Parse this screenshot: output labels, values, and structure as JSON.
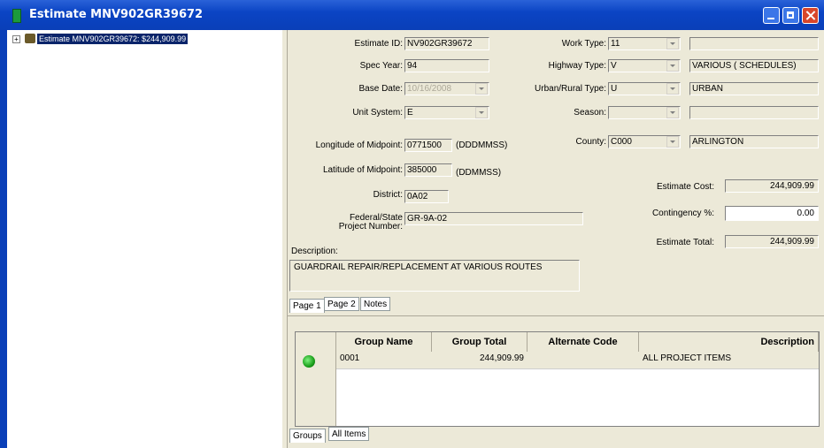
{
  "window": {
    "title": "Estimate MNV902GR39672",
    "accent": "#0b44c4"
  },
  "tree": {
    "node_label": "Estimate MNV902GR39672: $244,909.99",
    "expander": "+"
  },
  "form": {
    "estimate_id_label": "Estimate ID:",
    "estimate_id": "NV902GR39672",
    "spec_year_label": "Spec Year:",
    "spec_year": "94",
    "base_date_label": "Base Date:",
    "base_date": "10/16/2008",
    "unit_system_label": "Unit System:",
    "unit_system": "E",
    "work_type_label": "Work Type:",
    "work_type": "11",
    "work_type_desc": "",
    "highway_type_label": "Highway Type:",
    "highway_type": "V",
    "highway_type_desc": "VARIOUS ( SCHEDULES)",
    "urban_rural_label": "Urban/Rural Type:",
    "urban_rural": "U",
    "urban_rural_desc": "URBAN",
    "season_label": "Season:",
    "season": "",
    "season_desc": "",
    "county_label": "County:",
    "county": "C000",
    "county_desc": "ARLINGTON",
    "longitude_label": "Longitude of Midpoint:",
    "longitude": "0771500",
    "longitude_unit": "(DDDMMSS)",
    "latitude_label": "Latitude of Midpoint:",
    "latitude": "385000",
    "latitude_unit": "(DDMMSS)",
    "district_label": "District:",
    "district": "0A02",
    "fed_project_label_1": "Federal/State",
    "fed_project_label_2": "Project Number:",
    "fed_project": "GR-9A-02",
    "estimate_cost_label": "Estimate Cost:",
    "estimate_cost": "244,909.99",
    "contingency_label": "Contingency %:",
    "contingency": "0.00",
    "estimate_total_label": "Estimate Total:",
    "estimate_total": "244,909.99",
    "description_label": "Description:",
    "description": "GUARDRAIL REPAIR/REPLACEMENT AT VARIOUS ROUTES"
  },
  "form_tabs": [
    "Page 1",
    "Page 2",
    "Notes"
  ],
  "grid": {
    "headers": [
      "Group Name",
      "Group Total",
      "Alternate Code",
      "Description"
    ],
    "rows": [
      {
        "group_name": "0001",
        "group_total": "244,909.99",
        "alternate_code": "",
        "description": "ALL PROJECT ITEMS"
      }
    ]
  },
  "bottom_tabs": [
    "Groups",
    "All Items"
  ]
}
